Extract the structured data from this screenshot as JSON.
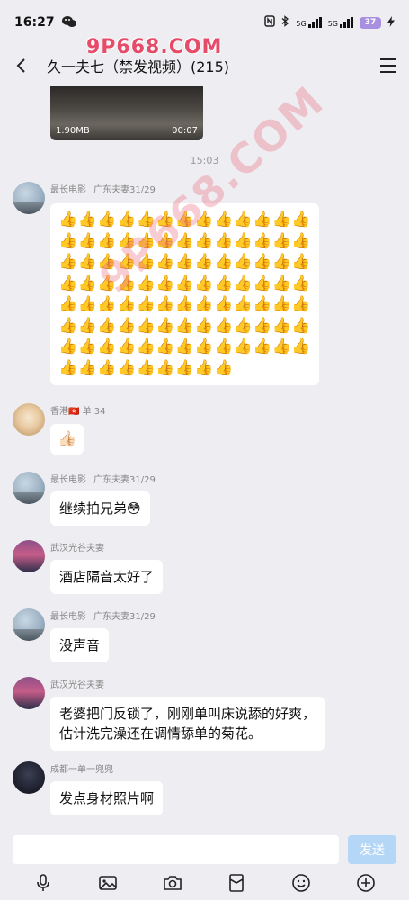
{
  "status_bar": {
    "time": "16:27",
    "wechat_icon": "wechat-icon",
    "nfc_icon": "nfc-icon",
    "bluetooth_icon": "bluetooth-icon",
    "signal_1": "5G",
    "signal_2": "5G",
    "battery": "37",
    "charging_icon": "bolt-icon"
  },
  "watermark_top": "9P668.COM",
  "watermark_diagonal": "9P668.COM",
  "header": {
    "title": "久一夫七（禁发视频）(215)",
    "back_icon": "chevron-left-icon",
    "menu_icon": "menu-icon"
  },
  "video": {
    "size": "1.90MB",
    "duration": "00:07"
  },
  "time_separator": "15:03",
  "messages": [
    {
      "sender": "最长电影",
      "tag": "广东夫妻31/29",
      "avatar": "sky-avatar",
      "type": "emoji_grid",
      "emoji": "👍",
      "rows": 8,
      "cols": 13,
      "last_row_count": 9
    },
    {
      "sender": "香港🇭🇰 单 34",
      "tag": "",
      "avatar": "girl-avatar",
      "text": "👍🏻"
    },
    {
      "sender": "最长电影",
      "tag": "广东夫妻31/29",
      "avatar": "sky-avatar",
      "text": "继续拍兄弟😳"
    },
    {
      "sender": "武汉光谷夫妻",
      "tag": "",
      "avatar": "city-avatar",
      "text": "酒店隔音太好了"
    },
    {
      "sender": "最长电影",
      "tag": "广东夫妻31/29",
      "avatar": "sky-avatar",
      "text": "没声音"
    },
    {
      "sender": "武汉光谷夫妻",
      "tag": "",
      "avatar": "city-avatar",
      "text_line1": "老婆把门反锁了，刚刚单叫床说舔的好爽，",
      "text_line2": "估计洗完澡还在调情舔单的菊花。"
    },
    {
      "sender": "成都一单一兜兜",
      "tag": "",
      "avatar": "dark-avatar",
      "text": "发点身材照片啊"
    }
  ],
  "input": {
    "placeholder": "",
    "value": "",
    "send_label": "发送"
  },
  "toolbar": [
    "microphone-icon",
    "image-icon",
    "camera-icon",
    "red-packet-icon",
    "emoji-icon",
    "plus-icon"
  ]
}
